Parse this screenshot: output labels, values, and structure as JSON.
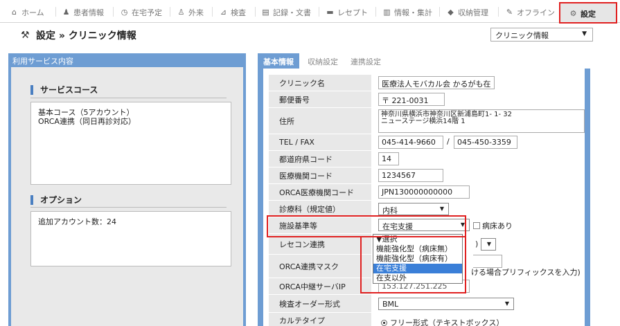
{
  "nav": {
    "items": [
      {
        "label": "ホーム",
        "icon": "home-icon"
      },
      {
        "label": "患者情報",
        "icon": "patient-icon"
      },
      {
        "label": "在宅予定",
        "icon": "clock-icon"
      },
      {
        "label": "外来",
        "icon": "outpatient-icon"
      },
      {
        "label": "検査",
        "icon": "exam-icon"
      },
      {
        "label": "記録・文書",
        "icon": "document-icon"
      },
      {
        "label": "レセプト",
        "icon": "receipt-icon"
      },
      {
        "label": "情報・集計",
        "icon": "stats-icon"
      },
      {
        "label": "収納管理",
        "icon": "tag-icon"
      },
      {
        "label": "オフライン",
        "icon": "offline-icon"
      }
    ],
    "active": {
      "label": "設定",
      "icon": "gear-icon"
    }
  },
  "page": {
    "title": "設定 » クリニック情報",
    "select_value": "クリニック情報"
  },
  "left": {
    "header": "利用サービス内容",
    "service_course_title": "サービスコース",
    "service_course_lines": [
      "基本コース（5アカウント）",
      "ORCA連携（同日再診対応）"
    ],
    "options_title": "オプション",
    "options_text": "追加アカウント数：24"
  },
  "tabs": [
    "基本情報",
    "収納設定",
    "連携設定"
  ],
  "form": {
    "clinic_name": {
      "label": "クリニック名",
      "value": "医療法人モバカル会 かるがも在"
    },
    "postal": {
      "label": "郵便番号",
      "prefix": "〒",
      "value": "221-0031"
    },
    "address": {
      "label": "住所",
      "line1": "神奈川県横浜市神奈川区新浦島町1- 1- 32",
      "line2": "ニューステージ横浜14階 1"
    },
    "tel_fax": {
      "label": "TEL / FAX",
      "tel": "045-414-9660",
      "sep": "/",
      "fax": "045-450-3359"
    },
    "pref_code": {
      "label": "都道府県コード",
      "value": "14"
    },
    "inst_code": {
      "label": "医療機関コード",
      "value": "1234567"
    },
    "orca_code": {
      "label": "ORCA医療機関コード",
      "value": "JPN130000000000"
    },
    "dept": {
      "label": "診療科（規定値）",
      "value": "内科"
    },
    "facility": {
      "label": "施設基準等",
      "value": "在宅支援",
      "checkbox_label": "病床あり"
    },
    "rececon": {
      "label": "レセコン連携",
      "partial": ")"
    },
    "orca_mask": {
      "label": "ORCA連携マスク",
      "hint": "ける場合プリフィックスを入力)"
    },
    "orca_relay": {
      "label": "ORCA中継サーバIP",
      "value": "153.127.251.225"
    },
    "exam_order": {
      "label": "検査オーダー形式",
      "value": "BML"
    },
    "karte_type": {
      "label": "カルテタイプ",
      "value": "フリー形式（テキストボックス）"
    }
  },
  "dropdown": {
    "options": [
      "▼選択",
      "機能強化型（病床無）",
      "機能強化型（病床有）",
      "在宅支援",
      "在支以外"
    ],
    "selected_index": 3
  },
  "colors": {
    "accent": "#6e9dd3",
    "highlight": "#e02020",
    "selected": "#3a7fd8"
  }
}
